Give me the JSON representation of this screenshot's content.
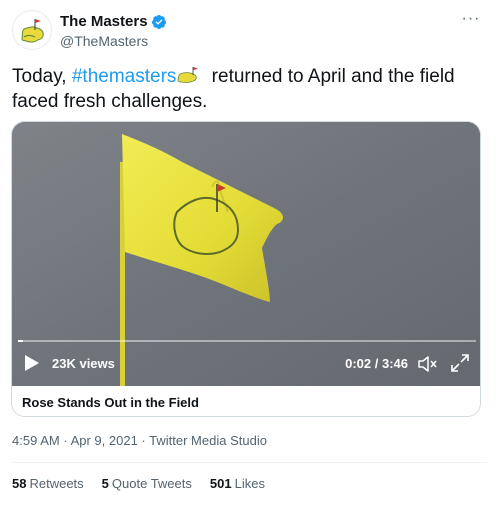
{
  "header": {
    "display_name": "The Masters",
    "handle": "@TheMasters",
    "avatar_icon": "masters-logo-icon",
    "verified_icon": "verified-badge-icon",
    "more_icon": "more-options-icon"
  },
  "tweet": {
    "text_before": "Today, ",
    "hashtag": "#themasters",
    "text_after": " returned to April and the field faced fresh challenges.",
    "inline_icon": "masters-logo-icon"
  },
  "video": {
    "views": "23K views",
    "time": "0:02 / 3:46",
    "progress": 0.01,
    "play_icon": "play-icon",
    "mute_icon": "volume-muted-icon",
    "fullscreen_icon": "fullscreen-icon",
    "caption": "Rose Stands Out in the Field"
  },
  "meta": {
    "time": "4:59 AM",
    "separator": "·",
    "date": "Apr 9, 2021",
    "source": "Twitter Media Studio"
  },
  "stats": {
    "retweets_count": "58",
    "retweets_label": "Retweets",
    "quotes_count": "5",
    "quotes_label": "Quote Tweets",
    "likes_count": "501",
    "likes_label": "Likes"
  },
  "colors": {
    "link": "#1d9bf0",
    "text": "#0f1419",
    "secondary": "#536471",
    "flag": "#e8e23a"
  }
}
